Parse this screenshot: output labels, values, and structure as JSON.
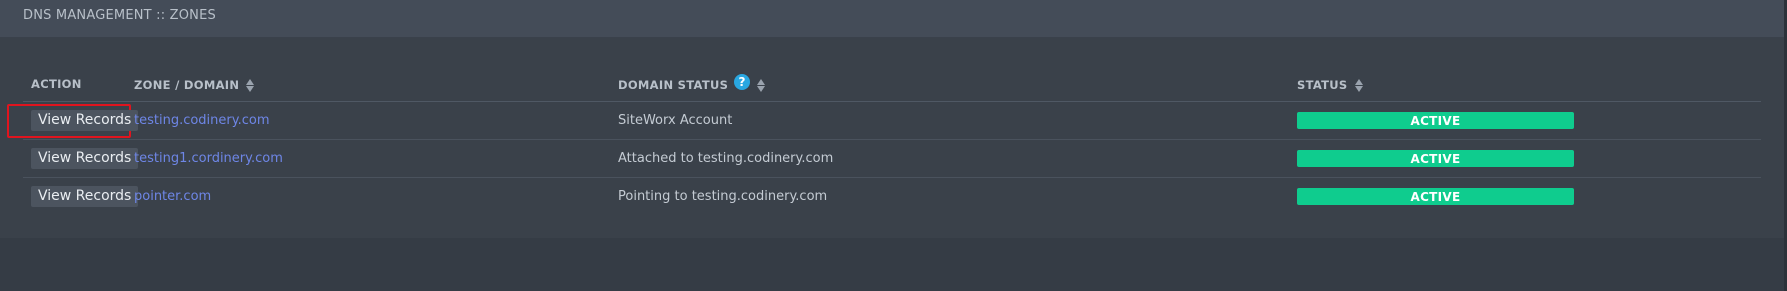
{
  "header": {
    "title": "DNS MANAGEMENT :: ZONES"
  },
  "table": {
    "columns": [
      {
        "label": "ACTION",
        "sortable": false,
        "help": false
      },
      {
        "label": "ZONE / DOMAIN",
        "sortable": true,
        "help": false
      },
      {
        "label": "DOMAIN STATUS",
        "sortable": true,
        "help": true
      },
      {
        "label": "STATUS",
        "sortable": true,
        "help": false
      }
    ],
    "help_glyph": "?",
    "rows": [
      {
        "action": "View Records",
        "zone": "testing.codinery.com",
        "domain_status": "SiteWorx Account",
        "status": "ACTIVE",
        "highlighted": true
      },
      {
        "action": "View Records",
        "zone": "testing1.cordinery.com",
        "domain_status": "Attached to testing.codinery.com",
        "status": "ACTIVE",
        "highlighted": false
      },
      {
        "action": "View Records",
        "zone": "pointer.com",
        "domain_status": "Pointing to testing.codinery.com",
        "status": "ACTIVE",
        "highlighted": false
      }
    ]
  },
  "colors": {
    "link": "#6e86e6",
    "status_active": "#0fcc8e",
    "highlight": "#e0141e",
    "help": "#29a7e1"
  }
}
